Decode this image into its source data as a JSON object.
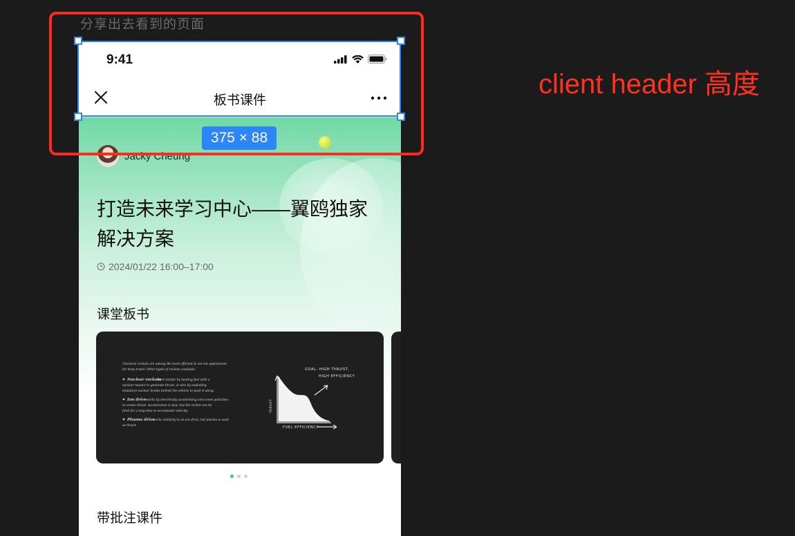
{
  "canvas": {
    "frame_caption": "分享出去看到的页面",
    "annotation": "client header 高度",
    "size_badge": "375 × 88",
    "colors": {
      "selection": "#2d86f5",
      "annotation": "#ff2a1c",
      "background": "#1b1b1b"
    }
  },
  "phone": {
    "status_bar": {
      "time": "9:41",
      "icons": [
        "signal-icon",
        "wifi-icon",
        "battery-icon"
      ]
    },
    "nav": {
      "title": "板书课件",
      "left_icon": "close-icon",
      "right_icon": "more-icon"
    },
    "hero": {
      "author": "Jacky Cheung",
      "title": "打造未来学习中心——翼鸥独家解决方案",
      "title_line1": "打造未来学习中心——翼鸥独家",
      "title_line2": "解决方案",
      "datetime": "2024/01/22 16:00–17:00"
    },
    "sections": {
      "board": "课堂板书",
      "annotated": "带批注课件"
    },
    "carousel": {
      "count": 3,
      "active": 0
    },
    "board_image": {
      "chart_label_top": "GOAL: HIGH THRUST,",
      "chart_label_top2": "HIGH EFFICIENCY",
      "chart_xlabel": "FUEL EFFICIENCY",
      "chart_ylabel": "THRUST",
      "note_intro_1": "Chemical rockets are among the least efficient & are not appropriate",
      "note_intro_2": "for deep travel. Other types of rockets available:",
      "bullet_1_title": "Nuclear rockets",
      "bullet_1_line1": "work similar by heating fuel with a",
      "bullet_1_line2": "nuclear reactor to generate thrust, or also by exploding",
      "bullet_1_line3": "miniature nuclear bombs behind the vehicle to push it along.",
      "bullet_2_title": "Ion drive",
      "bullet_2_line1": "works by electrically accelerating ions (even particles)",
      "bullet_2_line2": "to create thrust. Acceleration is slow, but the rocket can be",
      "bullet_2_line3": "fired for a long time to accumulate velocity.",
      "bullet_3_title": "Plasma drive",
      "bullet_3_line1": "works similarly to an ion drive, but plasma is used",
      "bullet_3_line2": "as thrust."
    }
  }
}
